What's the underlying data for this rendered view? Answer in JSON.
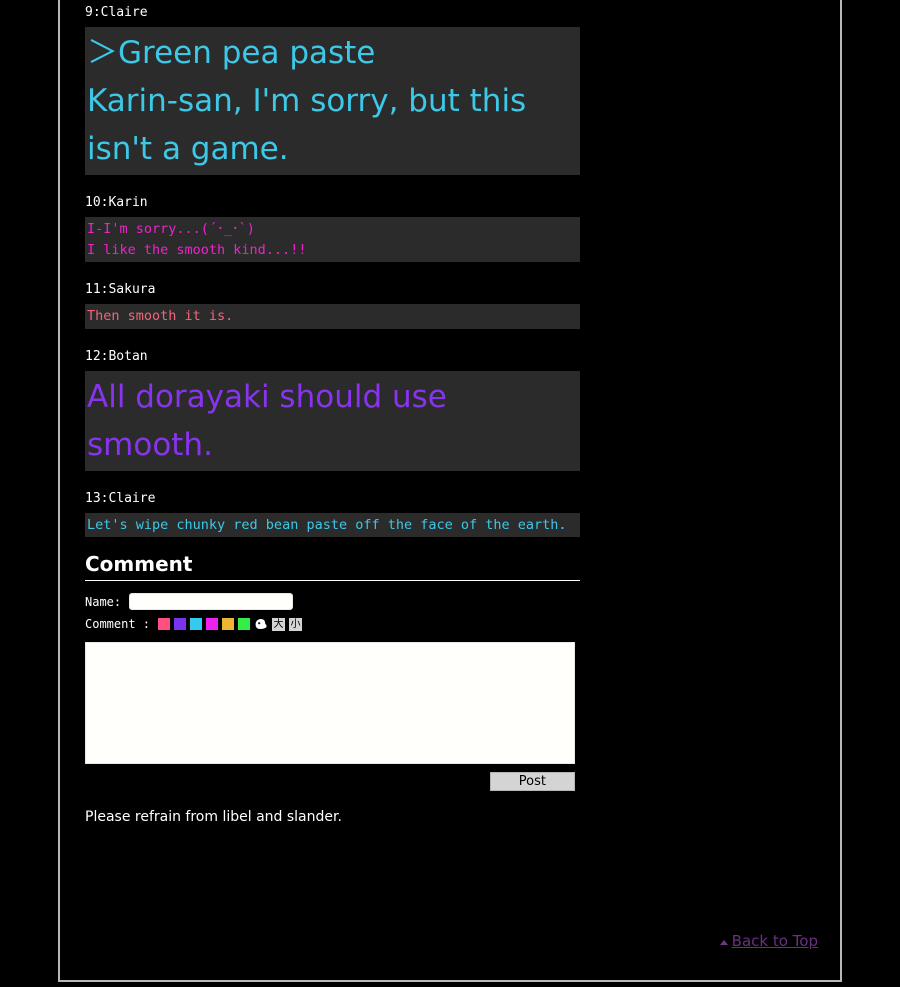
{
  "board": {
    "posts": [
      {
        "header": "9:Claire",
        "style": "style-big-cyan",
        "lines": [
          "＞Green pea paste",
          "Karin-san, I'm sorry, but this",
          "isn't a game."
        ]
      },
      {
        "header": "10:Karin",
        "style": "style-mono-magenta",
        "lines": [
          "I-I'm sorry...(´･_･`)",
          "I like the smooth kind...!!"
        ]
      },
      {
        "header": "11:Sakura",
        "style": "style-mono-salmon",
        "lines": [
          "Then smooth it is."
        ]
      },
      {
        "header": "12:Botan",
        "style": "style-big-purple",
        "lines": [
          "All dorayaki should use",
          "smooth."
        ]
      },
      {
        "header": "13:Claire",
        "style": "style-mono-cyan",
        "lines": [
          "Let's wipe chunky red bean paste off the face of the earth."
        ]
      }
    ]
  },
  "form": {
    "title": "Comment",
    "name_label": "Name:",
    "name_value": "",
    "name_placeholder": "",
    "comment_label": "Comment :",
    "comment_value": "",
    "comment_placeholder": "",
    "post_label": "Post",
    "notice": "Please refrain from libel and slander.",
    "swatches": [
      {
        "name": "color-swatch-pink",
        "color": "#ff4f80"
      },
      {
        "name": "color-swatch-purple",
        "color": "#7a33ee"
      },
      {
        "name": "color-swatch-cyan",
        "color": "#33ccee"
      },
      {
        "name": "color-swatch-magenta",
        "color": "#ee22ee"
      },
      {
        "name": "color-swatch-orange",
        "color": "#edb333"
      },
      {
        "name": "color-swatch-green",
        "color": "#33ee44"
      }
    ],
    "tools": [
      {
        "name": "eraser-ghost-icon",
        "label": ""
      },
      {
        "name": "text-size-large-button",
        "label": "大"
      },
      {
        "name": "text-size-small-button",
        "label": "小"
      }
    ]
  },
  "footer": {
    "back_to_top": "Back to Top"
  }
}
